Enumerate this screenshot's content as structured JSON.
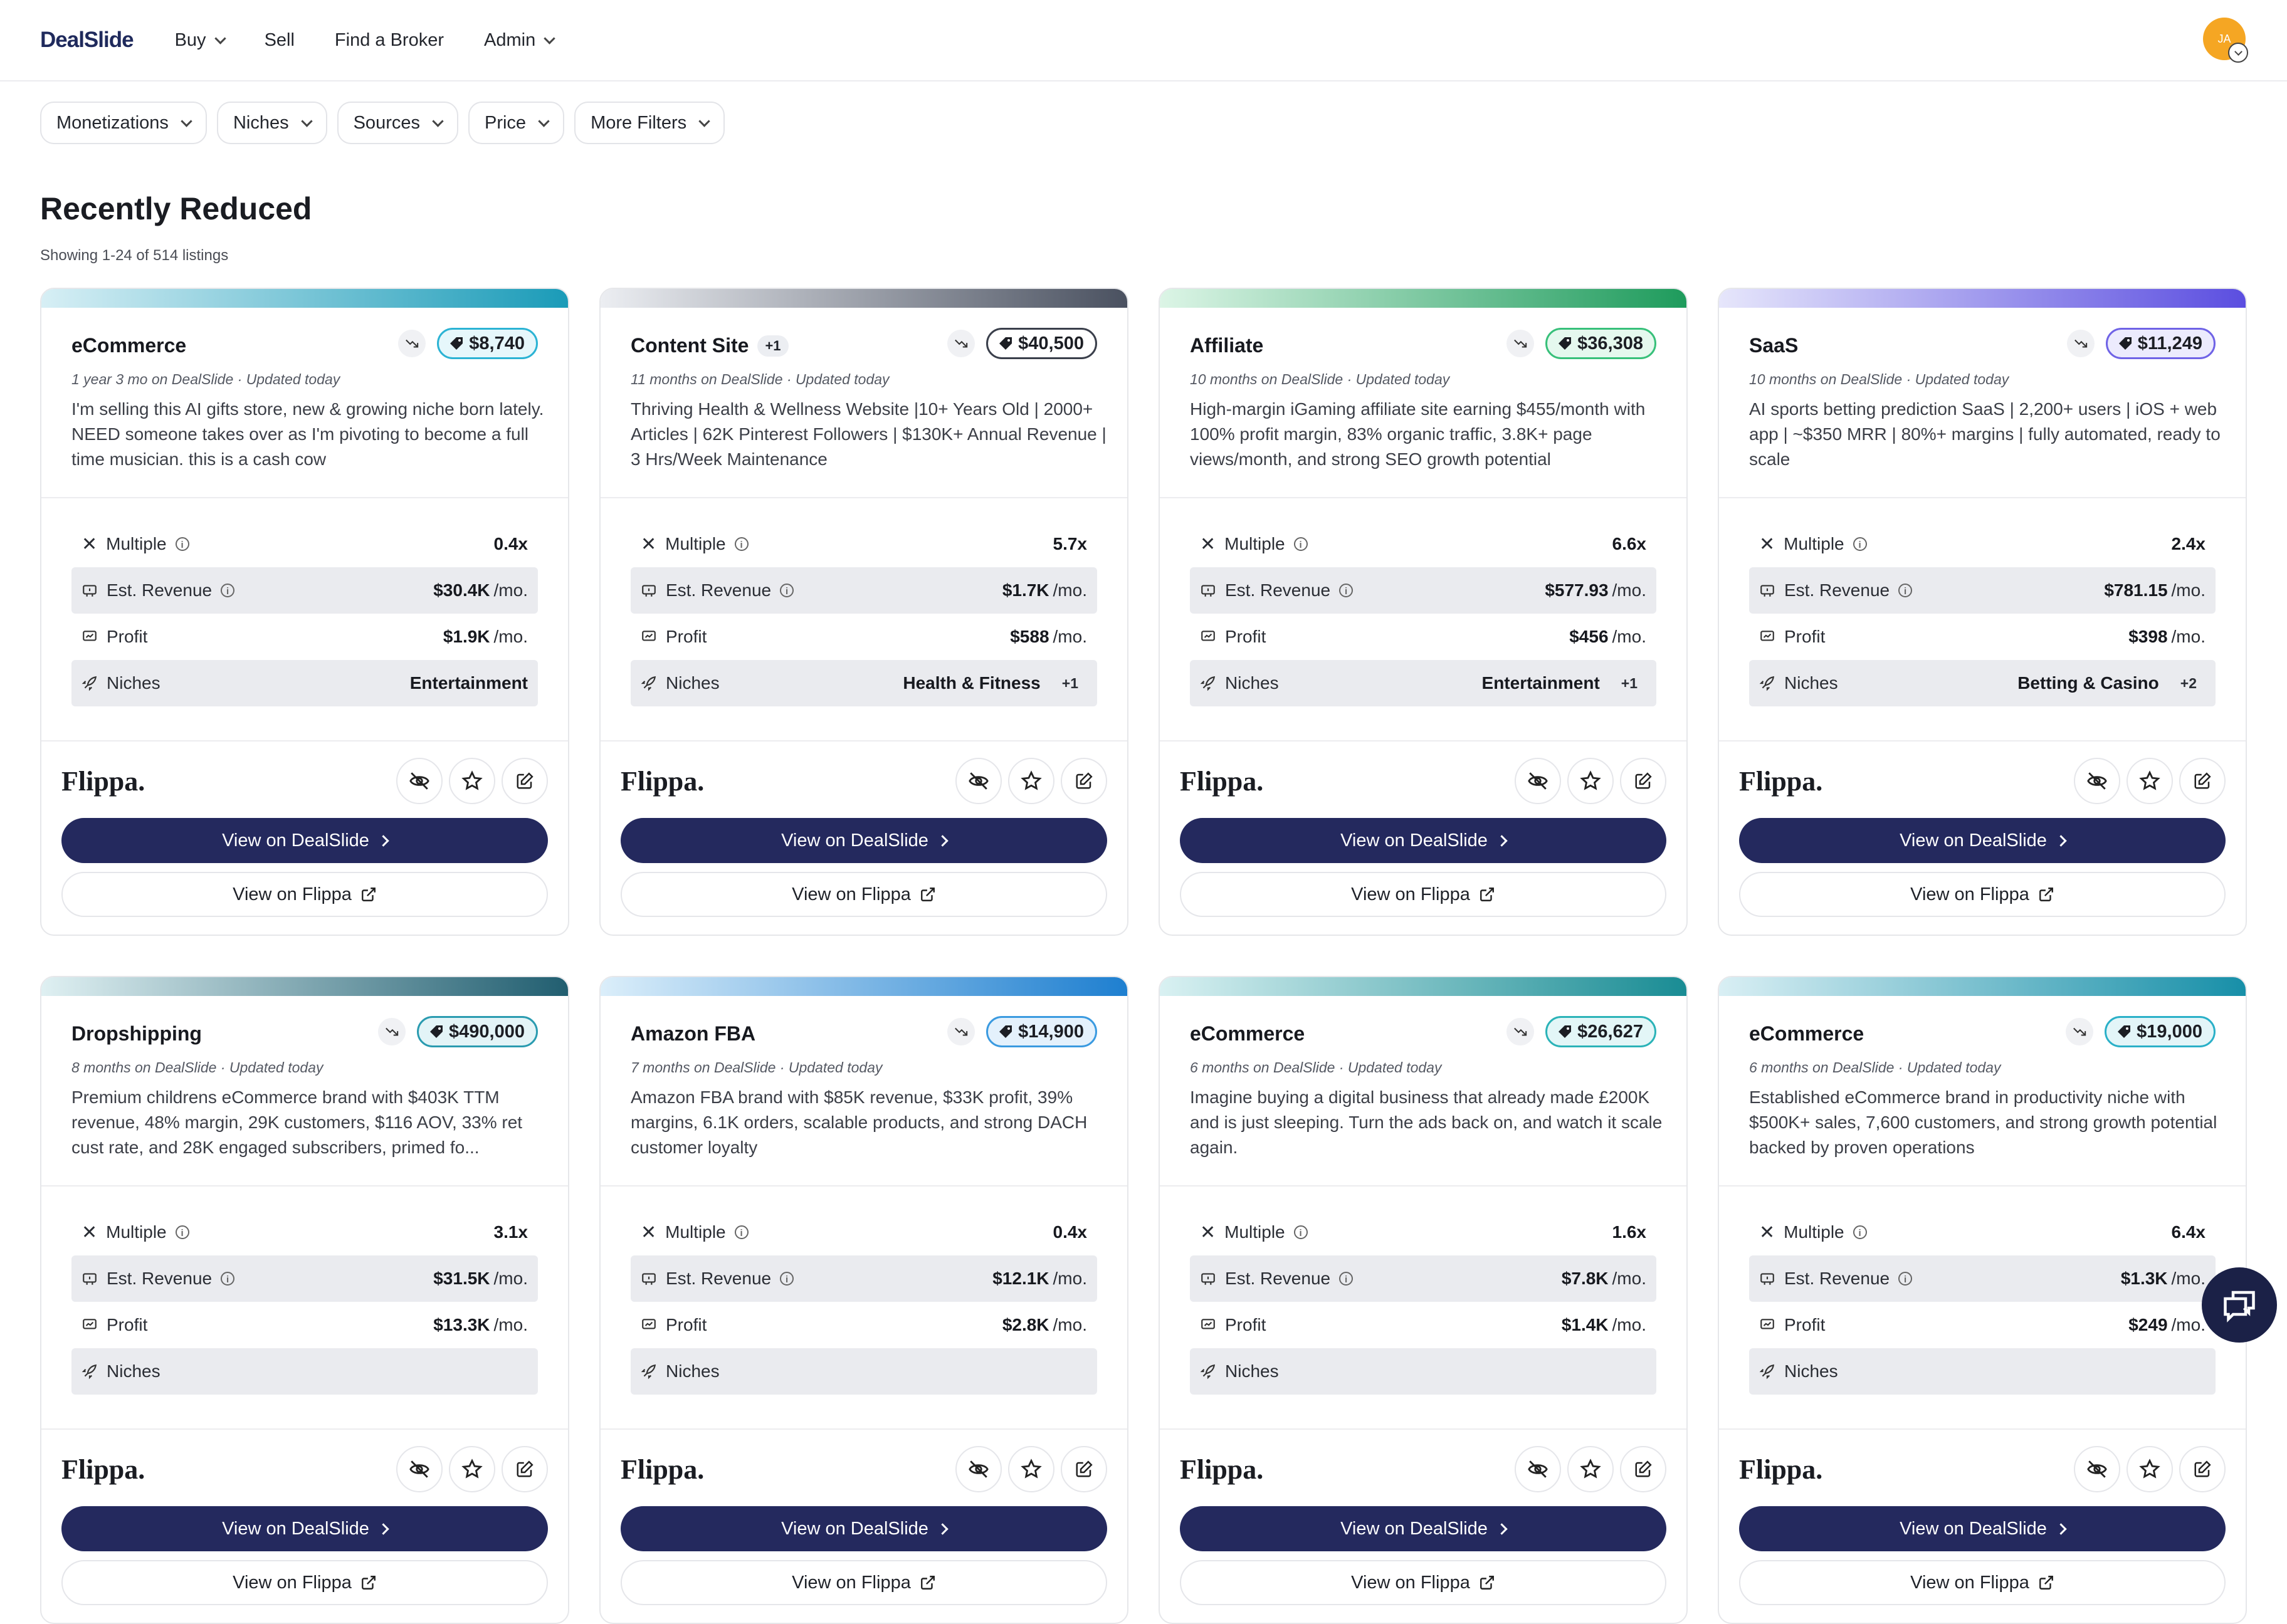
{
  "nav": {
    "logo": "DealSlide",
    "items": [
      {
        "label": "Buy",
        "has_dropdown": true
      },
      {
        "label": "Sell",
        "has_dropdown": false
      },
      {
        "label": "Find a Broker",
        "has_dropdown": false
      },
      {
        "label": "Admin",
        "has_dropdown": true
      }
    ],
    "avatar_initials": "JA"
  },
  "filters": [
    "Monetizations",
    "Niches",
    "Sources",
    "Price",
    "More Filters"
  ],
  "heading": "Recently Reduced",
  "subheading": "Showing 1-24 of 514 listings",
  "labels": {
    "multiple": "Multiple",
    "est_revenue": "Est. Revenue",
    "profit": "Profit",
    "niches": "Niches",
    "view_dealslide": "View on DealSlide",
    "view_flippa": "View on Flippa",
    "source": "Flippa."
  },
  "colors": {
    "primary_button": "#24295e",
    "shaded_row": "#eaebef",
    "avatar": "#f5a623"
  },
  "listings": [
    {
      "category": "eCommerce",
      "extra": "",
      "price": "$8,740",
      "meta": "1 year 3 mo on DealSlide · Updated today",
      "description": "I'm selling this AI gifts store, new & growing niche born lately. NEED someone takes over as I'm pivoting to become a full time musician. this is a cash cow",
      "multiple": "0.4x",
      "revenue": "$30.4K",
      "profit": "$1.9K",
      "niche": "Entertainment",
      "niche_extra": "",
      "gradient": [
        "#d7eff5",
        "#1a9bb8"
      ],
      "price_border": "#2bb3d4",
      "price_bg": "#e6f7fb"
    },
    {
      "category": "Content Site",
      "extra": "+1",
      "price": "$40,500",
      "meta": "11 months on DealSlide · Updated today",
      "description": "Thriving Health & Wellness Website |10+ Years Old | 2000+ Articles | 62K Pinterest Followers | $130K+ Annual Revenue | 3 Hrs/Week Maintenance",
      "multiple": "5.7x",
      "revenue": "$1.7K",
      "profit": "$588",
      "niche": "Health & Fitness",
      "niche_extra": "+1",
      "gradient": [
        "#eceef2",
        "#4a5160"
      ],
      "price_border": "#3a3f4b",
      "price_bg": "#ffffff"
    },
    {
      "category": "Affiliate",
      "extra": "",
      "price": "$36,308",
      "meta": "10 months on DealSlide · Updated today",
      "description": "High-margin iGaming affiliate site earning $455/month with 100% profit margin, 83% organic traffic, 3.8K+ page views/month, and strong SEO growth potential",
      "multiple": "6.6x",
      "revenue": "$577.93",
      "profit": "$456",
      "niche": "Entertainment",
      "niche_extra": "+1",
      "gradient": [
        "#dcf5e6",
        "#1e9b5c"
      ],
      "price_border": "#38c07a",
      "price_bg": "#e5f8ee"
    },
    {
      "category": "SaaS",
      "extra": "",
      "price": "$11,249",
      "meta": "10 months on DealSlide · Updated today",
      "description": "AI sports betting prediction SaaS | 2,200+ users | iOS + web app | ~$350 MRR | 80%+ margins | fully automated, ready to scale",
      "multiple": "2.4x",
      "revenue": "$781.15",
      "profit": "$398",
      "niche": "Betting & Casino",
      "niche_extra": "+2",
      "gradient": [
        "#e6e6fb",
        "#5b4ee0"
      ],
      "price_border": "#6f63e6",
      "price_bg": "#ecebfd"
    },
    {
      "category": "Dropshipping",
      "extra": "",
      "price": "$490,000",
      "meta": "8 months on DealSlide · Updated today",
      "description": "Premium childrens eCommerce brand with $403K TTM revenue, 48% margin, 29K customers, $116 AOV, 33% ret cust rate, and 28K engaged subscribers, primed fo...",
      "multiple": "3.1x",
      "revenue": "$31.5K",
      "profit": "$13.3K",
      "niche": "",
      "niche_extra": "",
      "gradient": [
        "#dff0f2",
        "#215e70"
      ],
      "price_border": "#2a9bb0",
      "price_bg": "#e3f4f7"
    },
    {
      "category": "Amazon FBA",
      "extra": "",
      "price": "$14,900",
      "meta": "7 months on DealSlide · Updated today",
      "description": "Amazon FBA brand with $85K revenue, $33K profit, 39% margins, 6.1K orders, scalable products, and strong DACH customer loyalty",
      "multiple": "0.4x",
      "revenue": "$12.1K",
      "profit": "$2.8K",
      "niche": "",
      "niche_extra": "",
      "gradient": [
        "#dbeefa",
        "#1e7fd0"
      ],
      "price_border": "#3a9ae0",
      "price_bg": "#e4f1fc"
    },
    {
      "category": "eCommerce",
      "extra": "",
      "price": "$26,627",
      "meta": "6 months on DealSlide · Updated today",
      "description": "Imagine buying a digital business that already made £200K and is just sleeping. Turn the ads back on, and watch it scale again.",
      "multiple": "1.6x",
      "revenue": "$7.8K",
      "profit": "$1.4K",
      "niche": "",
      "niche_extra": "",
      "gradient": [
        "#d9f1f2",
        "#198c94"
      ],
      "price_border": "#2bb3b8",
      "price_bg": "#e3f6f7"
    },
    {
      "category": "eCommerce",
      "extra": "",
      "price": "$19,000",
      "meta": "6 months on DealSlide · Updated today",
      "description": "Established eCommerce brand in productivity niche with $500K+ sales, 7,600 customers, and strong growth potential backed by proven operations",
      "multiple": "6.4x",
      "revenue": "$1.3K",
      "profit": "$249",
      "niche": "",
      "niche_extra": "",
      "gradient": [
        "#d9eff4",
        "#178fa8"
      ],
      "price_border": "#2ab0c8",
      "price_bg": "#e3f5f8"
    }
  ]
}
